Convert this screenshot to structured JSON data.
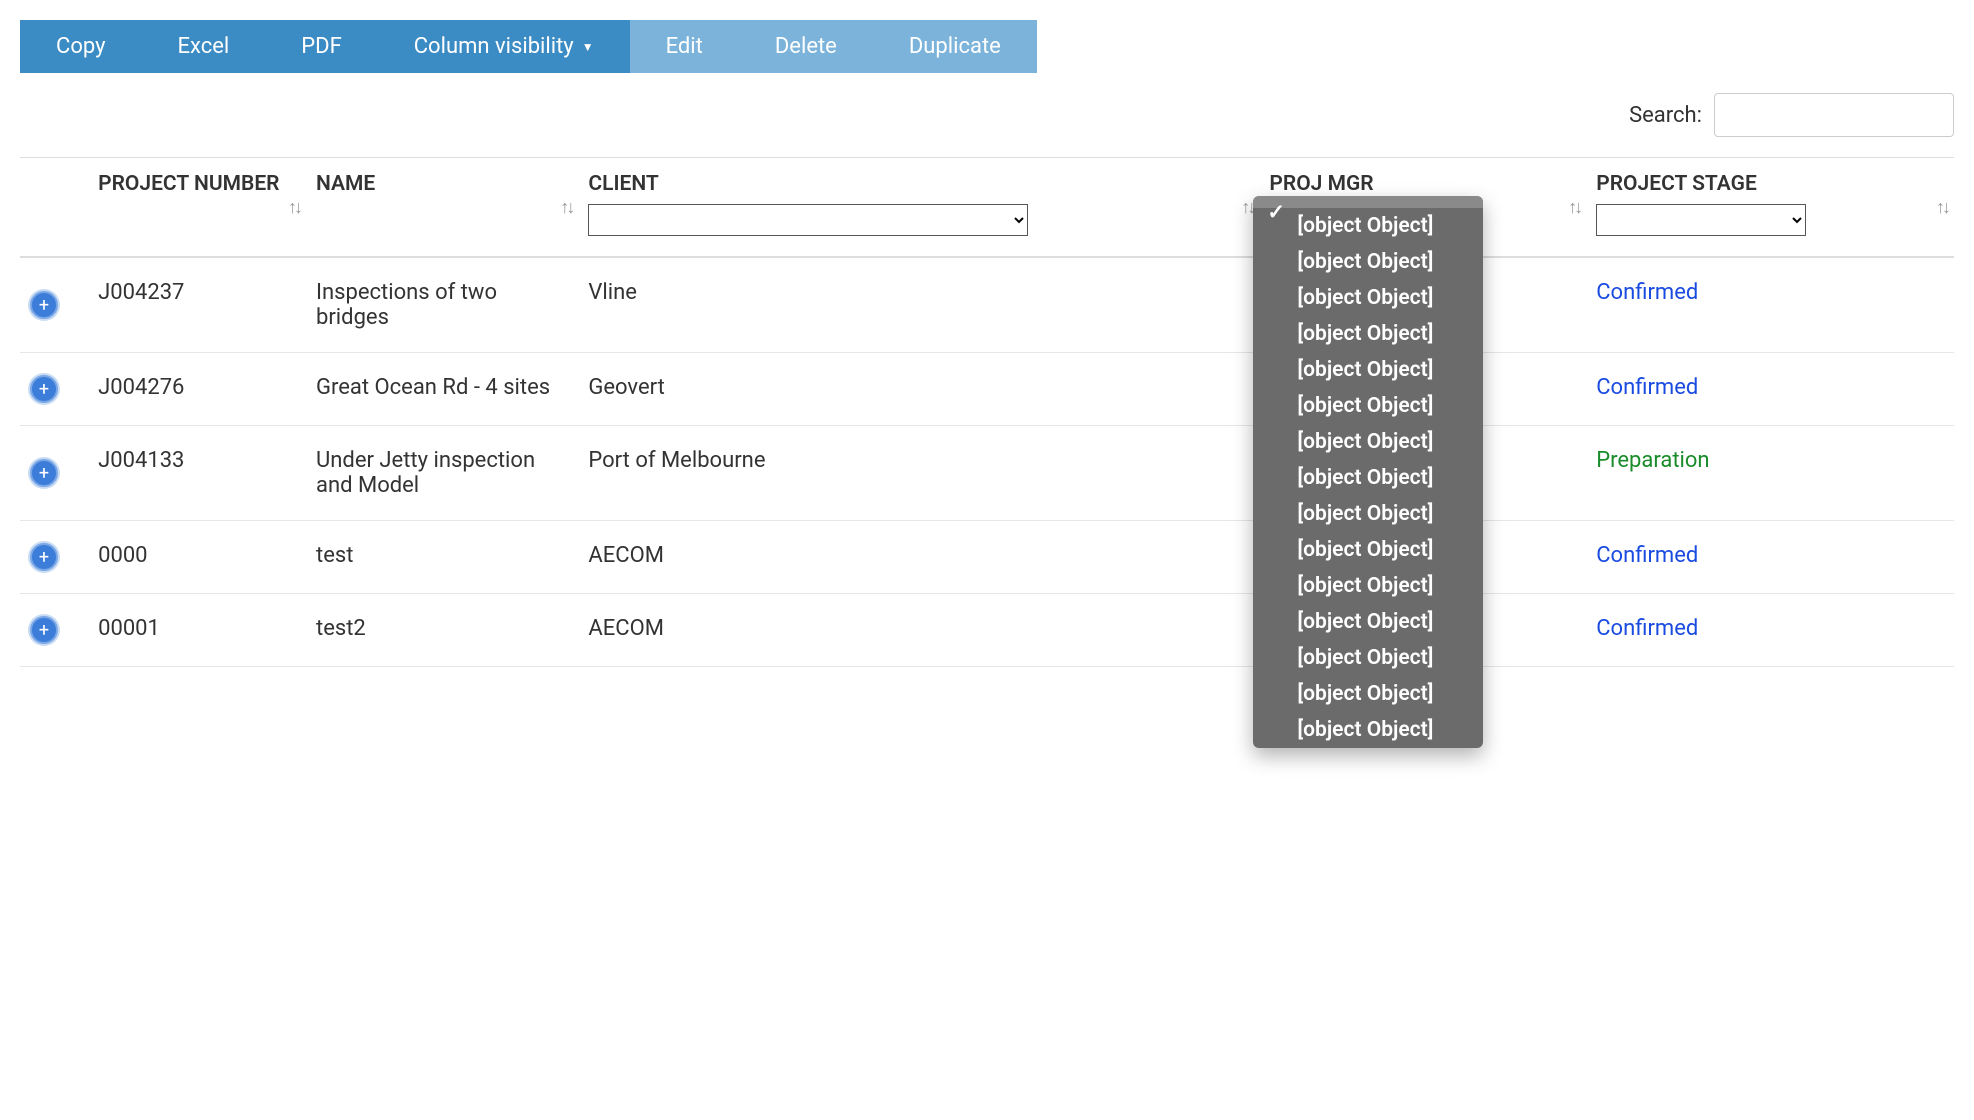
{
  "toolbar": {
    "copy": "Copy",
    "excel": "Excel",
    "pdf": "PDF",
    "column_visibility": "Column visibility",
    "edit": "Edit",
    "delete": "Delete",
    "duplicate": "Duplicate"
  },
  "search": {
    "label": "Search:",
    "value": ""
  },
  "columns": {
    "project_number": "PROJECT NUMBER",
    "name": "NAME",
    "client": "CLIENT",
    "proj_mgr": "PROJ MGR",
    "project_stage": "PROJECT STAGE"
  },
  "proj_mgr_dropdown": {
    "selected": "",
    "options": [
      "",
      "[object Object]",
      "[object Object]",
      "[object Object]",
      "[object Object]",
      "[object Object]",
      "[object Object]",
      "[object Object]",
      "[object Object]",
      "[object Object]",
      "[object Object]",
      "[object Object]",
      "[object Object]",
      "[object Object]",
      "[object Object]",
      "[object Object]"
    ]
  },
  "rows": [
    {
      "project_number": "J004237",
      "name": "Inspections of two bridges",
      "client": "Vline",
      "proj_mgr": "",
      "stage": "Confirmed",
      "stage_class": "stage-confirmed"
    },
    {
      "project_number": "J004276",
      "name": "Great Ocean Rd - 4 sites",
      "client": "Geovert",
      "proj_mgr": "",
      "stage": "Confirmed",
      "stage_class": "stage-confirmed"
    },
    {
      "project_number": "J004133",
      "name": "Under Jetty inspection and Model",
      "client": "Port of Melbourne",
      "proj_mgr": "",
      "stage": "Preparation",
      "stage_class": "stage-preparation"
    },
    {
      "project_number": "0000",
      "name": "test",
      "client": "AECOM",
      "proj_mgr": "",
      "stage": "Confirmed",
      "stage_class": "stage-confirmed"
    },
    {
      "project_number": "00001",
      "name": "test2",
      "client": "AECOM",
      "proj_mgr": "",
      "stage": "Confirmed",
      "stage_class": "stage-confirmed"
    }
  ]
}
